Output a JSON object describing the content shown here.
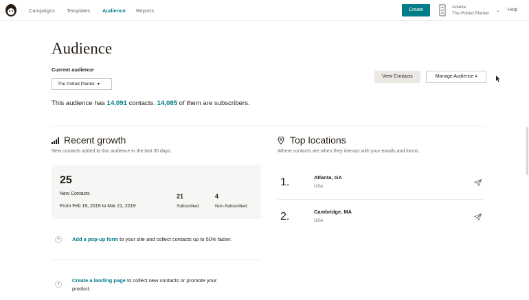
{
  "nav": {
    "items": [
      "Campaigns",
      "Templates",
      "Audience",
      "Reports"
    ],
    "active": "Audience",
    "create_label": "Create",
    "account_user": "Amelia",
    "account_org": "The Potted Planter",
    "help_label": "Help"
  },
  "page": {
    "title": "Audience",
    "current_audience_label": "Current audience",
    "audience_selected": "The Potted Planter",
    "view_contacts_label": "View Contacts",
    "manage_audience_label": "Manage Audience"
  },
  "summary": {
    "prefix": "This audience has",
    "total_contacts": "14,091",
    "middle": "contacts.",
    "subscribers": "14,085",
    "suffix": "of them are subscribers."
  },
  "growth": {
    "title": "Recent growth",
    "subtitle": "New contacts added to this audience in the last 30 days.",
    "new_count": "25",
    "new_label": "New Contacts",
    "date_range": "From Feb 19, 2019 to Mar 21, 2019",
    "subscribed_count": "21",
    "subscribed_label": "Subscribed",
    "nonsub_count": "4",
    "nonsub_label": "Non-Subscribed"
  },
  "ctas": [
    {
      "link": "Add a pop-up form",
      "text": "to your site and collect contacts up to 50% faster."
    },
    {
      "link": "Create a landing page",
      "text": "to collect new contacts or promote your",
      "text2": "product."
    }
  ],
  "locations": {
    "title": "Top locations",
    "subtitle": "Where contacts are when they interact with your emails and forms.",
    "items": [
      {
        "rank": "1.",
        "city": "Atlanta, GA",
        "country": "USA"
      },
      {
        "rank": "2.",
        "city": "Cambridge, MA",
        "country": "USA"
      }
    ]
  },
  "colors": {
    "accent": "#007c89",
    "card_bg": "#f6f6f4",
    "text": "#241c15"
  },
  "icons": [
    "mailchimp-logo-icon",
    "account-icon",
    "chevron-down-icon",
    "bar-chart-icon",
    "location-pin-icon",
    "plus-circle-icon",
    "send-icon",
    "cursor-icon"
  ]
}
